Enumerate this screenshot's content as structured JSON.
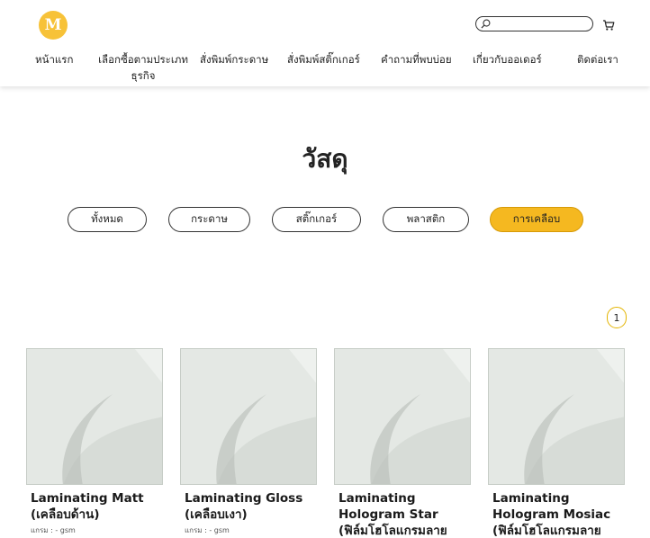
{
  "brand": {
    "logo_letter": "M"
  },
  "header": {
    "search_placeholder": "",
    "nav": [
      {
        "label": "หน้าแรก"
      },
      {
        "label": "เลือกซื้อตามประเภทธุรกิจ"
      },
      {
        "label": "สั่งพิมพ์กระดาษ"
      },
      {
        "label": "สั่งพิมพ์สติ๊กเกอร์"
      },
      {
        "label": "คำถามที่พบบ่อย"
      },
      {
        "label": "เกี่ยวกับออเดอร์"
      },
      {
        "label": "ติดต่อเรา"
      }
    ]
  },
  "page": {
    "title": "วัสดุ",
    "filters": [
      {
        "label": "ทั้งหมด",
        "active": false
      },
      {
        "label": "กระดาษ",
        "active": false
      },
      {
        "label": "สติ๊กเกอร์",
        "active": false
      },
      {
        "label": "พลาสติก",
        "active": false
      },
      {
        "label": "การเคลือบ",
        "active": true
      }
    ],
    "page_number": "1"
  },
  "products": [
    {
      "name": "Laminating Matt (เคลือบด้าน)",
      "meta": "แกรม : - gsm"
    },
    {
      "name": "Laminating Gloss (เคลือบเงา)",
      "meta": "แกรม : - gsm"
    },
    {
      "name": "Laminating Hologram Star (ฟิล์มโฮโลแกรมลายดาว)",
      "meta": ""
    },
    {
      "name": "Laminating Hologram Mosiac (ฟิล์มโฮโลแกรมลายโมเสก)",
      "meta": ""
    }
  ],
  "colors": {
    "accent": "#f5b820",
    "logo": "#f7c238",
    "thumb_bg": "#e4e8e4"
  },
  "icons": {
    "search": "search-icon",
    "cart": "cart-icon"
  }
}
